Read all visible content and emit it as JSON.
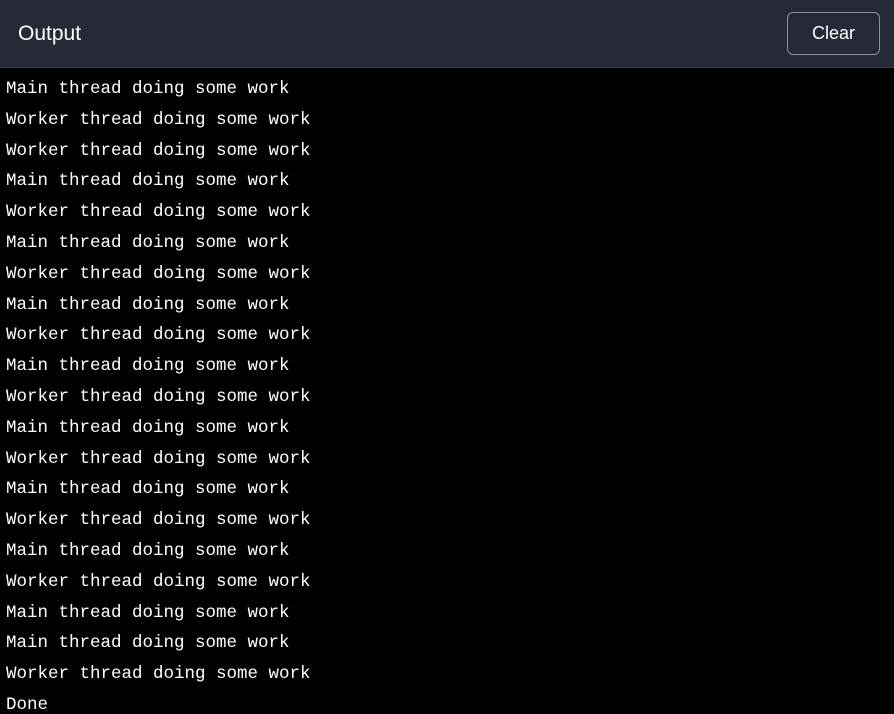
{
  "header": {
    "title": "Output",
    "clear_label": "Clear"
  },
  "output": {
    "lines": [
      "Main thread doing some work",
      "Worker thread doing some work",
      "Worker thread doing some work",
      "Main thread doing some work",
      "Worker thread doing some work",
      "Main thread doing some work",
      "Worker thread doing some work",
      "Main thread doing some work",
      "Worker thread doing some work",
      "Main thread doing some work",
      "Worker thread doing some work",
      "Main thread doing some work",
      "Worker thread doing some work",
      "Main thread doing some work",
      "Worker thread doing some work",
      "Main thread doing some work",
      "Worker thread doing some work",
      "Main thread doing some work",
      "Main thread doing some work",
      "Worker thread doing some work",
      "Done"
    ]
  }
}
